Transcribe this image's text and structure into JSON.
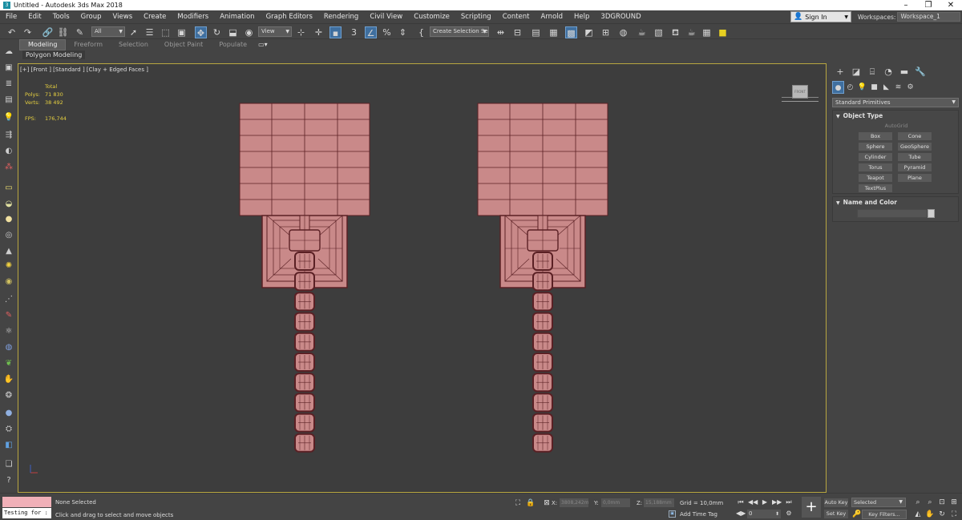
{
  "window": {
    "title": "Untitled - Autodesk 3ds Max 2018",
    "app_glyph": "3",
    "controls": [
      "–",
      "❐",
      "✕"
    ]
  },
  "menu": [
    "File",
    "Edit",
    "Tools",
    "Group",
    "Views",
    "Create",
    "Modifiers",
    "Animation",
    "Graph Editors",
    "Rendering",
    "Civil View",
    "Customize",
    "Scripting",
    "Content",
    "Arnold",
    "Help",
    "3DGROUND"
  ],
  "account": {
    "sign_in": "Sign In",
    "workspaces_label": "Workspaces:",
    "workspace": "Workspace_1"
  },
  "toolbar": {
    "selection_filter": "All",
    "ref_coord": "View",
    "named_selection": "Create Selection Se",
    "snaps_label": "3",
    "percent_snap": "%"
  },
  "ribbon": {
    "tabs": [
      "Modeling",
      "Freeform",
      "Selection",
      "Object Paint",
      "Populate"
    ],
    "active_tab": "Modeling",
    "sub_label": "Polygon Modeling"
  },
  "viewport": {
    "label": "[+] [Front ] [Standard ] [Clay + Edged Faces ]",
    "stats": {
      "total_label": "Total",
      "polys_label": "Polys:",
      "polys_value": "71 830",
      "verts_label": "Verts:",
      "verts_value": "38 492",
      "fps_label": "FPS:",
      "fps_value": "176,744"
    },
    "viewcube_face": "FRONT",
    "mesh_color": "#c98989",
    "mesh_line": "#5a2024",
    "border_color": "#b8a640"
  },
  "command_panel": {
    "primitive_type": "Standard Primitives",
    "object_type_title": "Object Type",
    "autogrid": "AutoGrid",
    "buttons": [
      "Box",
      "Cone",
      "Sphere",
      "GeoSphere",
      "Cylinder",
      "Tube",
      "Torus",
      "Pyramid",
      "Teapot",
      "Plane",
      "TextPlus"
    ],
    "name_color_title": "Name and Color"
  },
  "status": {
    "maxscript_text": "Testing for :",
    "selection": "None Selected",
    "prompt": "Click and drag to select and move objects",
    "x_label": "X:",
    "x_value": "3808,242m",
    "y_label": "Y:",
    "y_value": "0,0mm",
    "z_label": "Z:",
    "z_value": "15,188mm",
    "grid": "Grid = 10,0mm",
    "add_time_tag": "Add Time Tag",
    "frame": "0",
    "auto_key": "Auto Key",
    "set_key": "Set Key",
    "key_mode": "Selected",
    "key_filters": "Key Filters..."
  }
}
